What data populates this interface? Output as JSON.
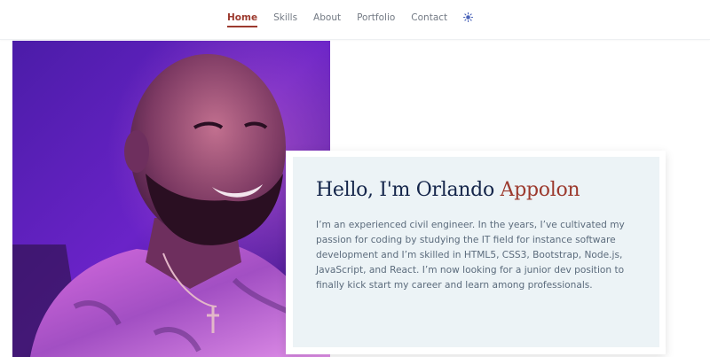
{
  "nav": {
    "items": [
      {
        "label": "Home",
        "active": true
      },
      {
        "label": "Skills",
        "active": false
      },
      {
        "label": "About",
        "active": false
      },
      {
        "label": "Portfolio",
        "active": false
      },
      {
        "label": "Contact",
        "active": false
      }
    ],
    "theme_toggle_icon": "sun-icon"
  },
  "hero": {
    "greeting": "Hello, I'm Orlando ",
    "last_name": "Appolon",
    "bio": "I’m an experienced civil engineer. In the years, I’ve cultivated my passion for coding by studying the IT field for instance software development and I’m skilled in HTML5, CSS3, Bootstrap, Node.js, JavaScript, and React. I’m now looking for a junior dev position to finally kick start my career and learn among professionals."
  },
  "colors": {
    "accent": "#9c3a2e",
    "title": "#14254a",
    "card_bg": "#ecf3f6",
    "body_text": "#5b6b7c",
    "nav_text": "#737a84"
  }
}
